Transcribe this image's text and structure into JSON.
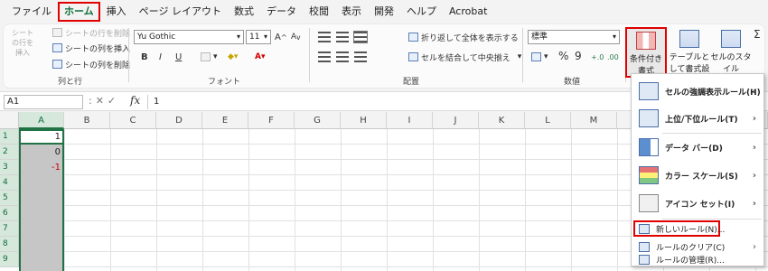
{
  "menu_tabs": [
    "ファイル",
    "ホーム",
    "挿入",
    "ページ レイアウト",
    "数式",
    "データ",
    "校閲",
    "表示",
    "開発",
    "ヘルプ",
    "Acrobat"
  ],
  "ribbon": {
    "cells_group": {
      "label": "列と行",
      "insert_row": "シートの行を挿入",
      "delete_row": "シートの行を削除",
      "insert_col": "シートの列を挿入",
      "delete_col": "シートの列を削除"
    },
    "font_group": {
      "label": "フォント",
      "font_name": "Yu Gothic",
      "font_size": "11",
      "bold": "B",
      "italic": "I",
      "underline": "U"
    },
    "align_group": {
      "label": "配置",
      "wrap_text": "折り返して全体を表示する",
      "merge_center": "セルを結合して中央揃え"
    },
    "number_group": {
      "label": "数値",
      "format": "標準",
      "percent": "%",
      "comma": "9"
    },
    "styles_group": {
      "conditional_formatting": "条件付き書式",
      "format_as_table": "テーブルとして書式設定",
      "cell_styles": "セルのスタイル"
    }
  },
  "formula_bar": {
    "name_box": "A1",
    "fx": "fx",
    "value": "1"
  },
  "grid": {
    "columns": [
      "A",
      "B",
      "C",
      "D",
      "E",
      "F",
      "G",
      "H",
      "I",
      "J",
      "K",
      "L",
      "M"
    ],
    "rows": [
      "1",
      "2",
      "3",
      "4",
      "5",
      "6",
      "7",
      "8",
      "9"
    ],
    "colA_values": [
      "1",
      "0",
      "-1"
    ]
  },
  "cf_menu": {
    "items": [
      {
        "label": "セルの強調表示ルール(H)",
        "submenu": true
      },
      {
        "label": "上位/下位ルール(T)",
        "submenu": true
      },
      {
        "label": "データ バー(D)",
        "submenu": true
      },
      {
        "label": "カラー スケール(S)",
        "submenu": true
      },
      {
        "label": "アイコン セット(I)",
        "submenu": true
      },
      {
        "label": "新しいルール(N)...",
        "submenu": false
      },
      {
        "label": "ルールのクリア(C)",
        "submenu": true
      },
      {
        "label": "ルールの管理(R)...",
        "submenu": false
      }
    ]
  },
  "colors": {
    "accent_green": "#217346",
    "highlight_red": "#e00000"
  }
}
